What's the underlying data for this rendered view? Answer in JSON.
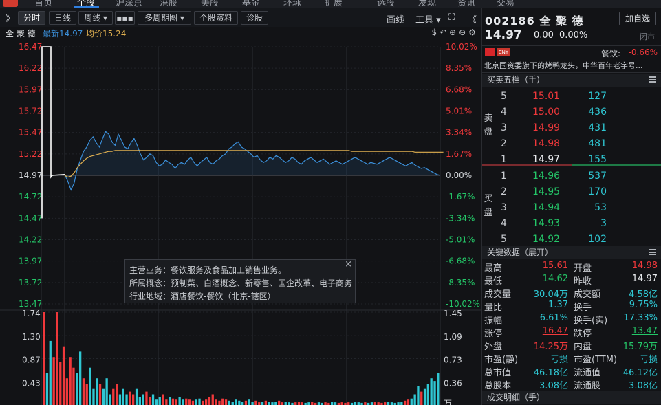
{
  "nav": {
    "tabs": [
      "首页",
      "个股",
      "沪深京",
      "港股",
      "美股",
      "基金",
      "环球",
      "扩展",
      "选股",
      "发现",
      "资讯",
      "交易"
    ],
    "active_index": 1
  },
  "toolbar": {
    "expand": "》",
    "buttons": [
      "分时",
      "日线",
      "周线 ▾",
      "▪▪▪",
      "多周期图 ▾",
      "个股资料",
      "诊股"
    ],
    "active": "分时",
    "draw": "画线",
    "tools": "工具 ▾",
    "fullscreen": "⛶",
    "collapse": "《"
  },
  "legend": {
    "name": "全 聚 德",
    "latest": "最新14.97",
    "avg": "均价15.24",
    "icons": "$↶⊕⊖⚙"
  },
  "chart_data": {
    "type": "line",
    "title": "",
    "prev_close": 14.97,
    "ylim": [
      13.47,
      16.47
    ],
    "y_ticks_left": [
      "16.47",
      "16.22",
      "15.97",
      "15.72",
      "15.47",
      "15.22",
      "14.97",
      "14.72",
      "14.47",
      "14.22",
      "13.97",
      "13.72",
      "13.47"
    ],
    "y_ticks_right": [
      "10.02%",
      "8.35%",
      "6.68%",
      "5.01%",
      "3.34%",
      "1.67%",
      "0.00%",
      "-1.67%",
      "-3.34%",
      "-5.01%",
      "-6.68%",
      "-8.35%",
      "-10.02%"
    ],
    "price": [
      14.98,
      14.9,
      14.8,
      14.88,
      15.05,
      15.15,
      15.25,
      15.3,
      15.38,
      15.42,
      15.35,
      15.3,
      15.4,
      15.48,
      15.45,
      15.36,
      15.32,
      15.45,
      15.38,
      15.3,
      15.28,
      15.35,
      15.4,
      15.32,
      15.22,
      15.15,
      15.18,
      15.22,
      15.2,
      15.12,
      15.08,
      15.1,
      15.15,
      15.12,
      15.1,
      15.05,
      15.1,
      15.12,
      15.1,
      15.15,
      15.18,
      15.12,
      15.08,
      15.12,
      15.15,
      15.18,
      15.12,
      15.1,
      15.14,
      15.16,
      15.2,
      15.22,
      15.28,
      15.3,
      15.34,
      15.36,
      15.3,
      15.28,
      15.25,
      15.22,
      15.18,
      15.2,
      15.15,
      15.12,
      15.14,
      15.18,
      15.16,
      15.2,
      15.18,
      15.15,
      15.12,
      15.14,
      15.18,
      15.16,
      15.12,
      15.1,
      15.14,
      15.16,
      15.18,
      15.15,
      15.12,
      15.14,
      15.16,
      15.13,
      15.1,
      15.12,
      15.14,
      15.12,
      15.1,
      15.12,
      15.14,
      15.16,
      15.18,
      15.16,
      15.14,
      15.12,
      15.1,
      15.12,
      15.11,
      15.1,
      15.12,
      15.14,
      15.16,
      15.18,
      15.16,
      15.14,
      15.12,
      15.1,
      15.08,
      15.1,
      15.12,
      15.09,
      15.07,
      15.05,
      15.06,
      15.04,
      15.02,
      15.0,
      14.98,
      14.97
    ],
    "avg": [
      14.97,
      14.95,
      14.96,
      15.0,
      15.06,
      15.1,
      15.14,
      15.17,
      15.19,
      15.2,
      15.21,
      15.22,
      15.23,
      15.24,
      15.25,
      15.25,
      15.26,
      15.26,
      15.26,
      15.26,
      15.26,
      15.26,
      15.26,
      15.26,
      15.26,
      15.26,
      15.26,
      15.26,
      15.26,
      15.26,
      15.26,
      15.26,
      15.26,
      15.26,
      15.26,
      15.26,
      15.26,
      15.26,
      15.26,
      15.26,
      15.26,
      15.26,
      15.26,
      15.26,
      15.26,
      15.26,
      15.26,
      15.26,
      15.26,
      15.26,
      15.26,
      15.26,
      15.26,
      15.26,
      15.26,
      15.26,
      15.26,
      15.26,
      15.26,
      15.26,
      15.26,
      15.26,
      15.26,
      15.26,
      15.26,
      15.26,
      15.26,
      15.26,
      15.26,
      15.26,
      15.26,
      15.26,
      15.26,
      15.26,
      15.26,
      15.26,
      15.26,
      15.26,
      15.26,
      15.26,
      15.26,
      15.26,
      15.26,
      15.26,
      15.26,
      15.26,
      15.26,
      15.26,
      15.26,
      15.26,
      15.26,
      15.25,
      15.25,
      15.25,
      15.25,
      15.25,
      15.25,
      15.25,
      15.25,
      15.25,
      15.25,
      15.25,
      15.25,
      15.25,
      15.25,
      15.25,
      15.25,
      15.25,
      15.25,
      15.25,
      15.25,
      15.24,
      15.24,
      15.24,
      15.24,
      15.24,
      15.24,
      15.24,
      15.24,
      15.24,
      15.24
    ],
    "volume_ticks_left": [
      "1.74",
      "1.30",
      "0.87",
      "0.43"
    ],
    "volume_ticks_right": [
      "1.45",
      "1.09",
      "0.73",
      "0.36"
    ],
    "volume_unit": "万",
    "volume": [
      1.74,
      0.6,
      1.2,
      0.9,
      1.74,
      0.8,
      1.1,
      0.5,
      0.9,
      0.7,
      0.6,
      1.0,
      0.5,
      0.4,
      0.7,
      0.3,
      0.5,
      0.4,
      0.3,
      0.5,
      0.2,
      0.3,
      0.4,
      0.2,
      0.3,
      0.2,
      0.25,
      0.2,
      0.3,
      0.15,
      0.2,
      0.25,
      0.15,
      0.2,
      0.1,
      0.15,
      0.2,
      0.1,
      0.15,
      0.12,
      0.1,
      0.15,
      0.1,
      0.12,
      0.1,
      0.08,
      0.1,
      0.12,
      0.08,
      0.1,
      0.15,
      0.2,
      0.1,
      0.08,
      0.12,
      0.1,
      0.08,
      0.06,
      0.1,
      0.08,
      0.06,
      0.08,
      0.1,
      0.06,
      0.08,
      0.05,
      0.06,
      0.08,
      0.06,
      0.05,
      0.06,
      0.08,
      0.05,
      0.06,
      0.05,
      0.04,
      0.05,
      0.06,
      0.05,
      0.04,
      0.05,
      0.06,
      0.04,
      0.05,
      0.04,
      0.05,
      0.04,
      0.06,
      0.05,
      0.04,
      0.05,
      0.04,
      0.05,
      0.04,
      0.06,
      0.05,
      0.04,
      0.05,
      0.04,
      0.05,
      0.06,
      0.05,
      0.04,
      0.05,
      0.06,
      0.05,
      0.04,
      0.05,
      0.06,
      0.08,
      0.1,
      0.12,
      0.2,
      0.35,
      0.25,
      0.3,
      0.4,
      0.5,
      0.45,
      0.6
    ]
  },
  "tooltip": {
    "line1": "主营业务：餐饮服务及食品加工销售业务。",
    "line2": "所属概念：预制菜、白酒概念、新零售、国企改革、电子商务",
    "line3": "行业地域：酒店餐饮-餐饮（北京-辖区）",
    "close": "×"
  },
  "quote": {
    "code": "002186 全 聚 德",
    "add_button": "加自选",
    "price": "14.97",
    "change": "0.00",
    "change_pct": "0.00%",
    "status": "闭市",
    "cny": "CNY",
    "sector": "餐饮:",
    "sector_pct": "-0.66%",
    "description": "北京国资委旗下的烤鸭龙头，中华百年老字号..."
  },
  "orderbook": {
    "header": "买卖五档（手）",
    "sell_label": [
      "卖",
      "盘"
    ],
    "buy_label": [
      "买",
      "盘"
    ],
    "asks": [
      {
        "level": "5",
        "price": "15.01",
        "vol": "127"
      },
      {
        "level": "4",
        "price": "15.00",
        "vol": "436"
      },
      {
        "level": "3",
        "price": "14.99",
        "vol": "431"
      },
      {
        "level": "2",
        "price": "14.98",
        "vol": "481"
      },
      {
        "level": "1",
        "price": "14.97",
        "vol": "155"
      }
    ],
    "bids": [
      {
        "level": "1",
        "price": "14.96",
        "vol": "537"
      },
      {
        "level": "2",
        "price": "14.95",
        "vol": "170"
      },
      {
        "level": "3",
        "price": "14.94",
        "vol": "53"
      },
      {
        "level": "4",
        "price": "14.93",
        "vol": "3"
      },
      {
        "level": "5",
        "price": "14.92",
        "vol": "102"
      }
    ]
  },
  "keydata": {
    "header": "关键数据（展开）",
    "rows": [
      {
        "l1": "最高",
        "v1": "15.61",
        "c1": "red",
        "l2": "开盘",
        "v2": "14.98",
        "c2": "red"
      },
      {
        "l1": "最低",
        "v1": "14.62",
        "c1": "green",
        "l2": "昨收",
        "v2": "14.97",
        "c2": "white"
      },
      {
        "l1": "成交量",
        "v1": "30.04万",
        "c1": "cyan",
        "l2": "成交额",
        "v2": "4.58亿",
        "c2": "cyan"
      },
      {
        "l1": "量比",
        "v1": "1.37",
        "c1": "cyan",
        "l2": "换手",
        "v2": "9.75%",
        "c2": "cyan"
      },
      {
        "l1": "振幅",
        "v1": "6.61%",
        "c1": "cyan",
        "l2": "换手(实)",
        "v2": "17.33%",
        "c2": "cyan"
      },
      {
        "l1": "涨停",
        "v1": "16.47",
        "c1": "red",
        "l2": "跌停",
        "v2": "13.47",
        "c2": "green"
      },
      {
        "l1": "外盘",
        "v1": "14.25万",
        "c1": "red",
        "l2": "内盘",
        "v2": "15.79万",
        "c2": "green"
      },
      {
        "l1": "市盈(静)",
        "v1": "亏损",
        "c1": "cyan",
        "l2": "市盈(TTM)",
        "v2": "亏损",
        "c2": "cyan"
      },
      {
        "l1": "总市值",
        "v1": "46.18亿",
        "c1": "cyan",
        "l2": "流通值",
        "v2": "46.12亿",
        "c2": "cyan"
      },
      {
        "l1": "总股本",
        "v1": "3.08亿",
        "c1": "cyan",
        "l2": "流通股",
        "v2": "3.08亿",
        "c2": "cyan"
      }
    ]
  },
  "trades": {
    "header": "成交明细（手）"
  },
  "colors": {
    "up": "#f0383b",
    "down": "#24c768",
    "price_line": "#3b8fd9",
    "avg_line": "#e0b050",
    "accent": "#2f7fe0"
  }
}
